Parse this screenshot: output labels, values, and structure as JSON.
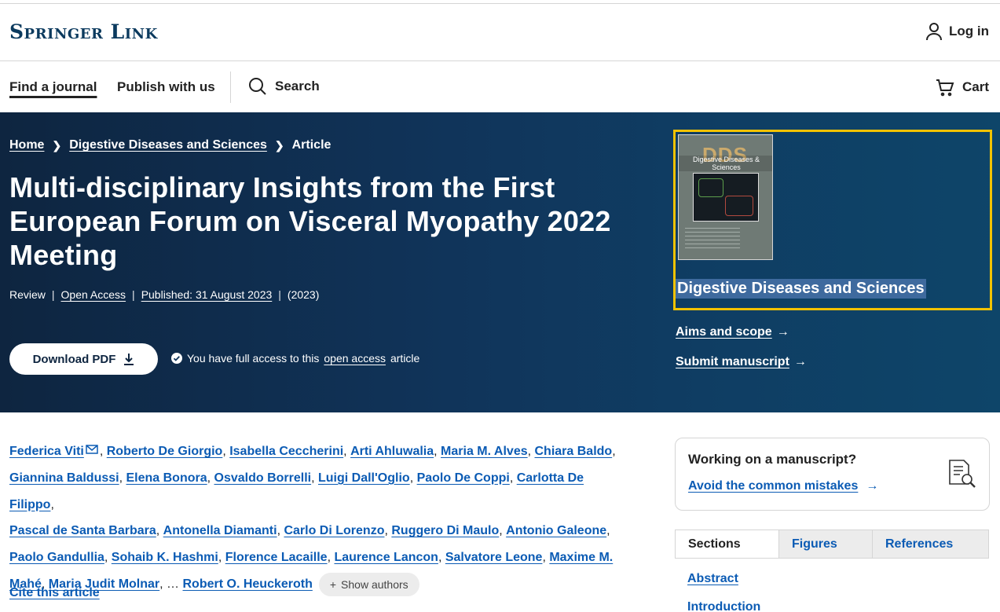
{
  "header": {
    "logo": "Springer Link",
    "login_label": "Log in"
  },
  "nav": {
    "find_journal": "Find a journal",
    "publish": "Publish with us",
    "search": "Search",
    "cart": "Cart"
  },
  "breadcrumb": {
    "home": "Home",
    "journal": "Digestive Diseases and Sciences",
    "current": "Article"
  },
  "article": {
    "title": "Multi-disciplinary Insights from the First European Forum on Visceral Myopathy 2022 Meeting",
    "type": "Review",
    "open_access": "Open Access",
    "published": "Published: 31 August 2023",
    "year": "(2023)",
    "download_label": "Download PDF",
    "access_prefix": "You have full access to this",
    "access_link": "open access",
    "access_suffix": "article"
  },
  "journal": {
    "name": "Digestive Diseases and Sciences",
    "cover_title": "Digestive Diseases & Sciences",
    "cover_abbrev": "DDS",
    "aims": "Aims and scope",
    "submit": "Submit manuscript"
  },
  "authors": [
    "Federica Viti",
    "Roberto De Giorgio",
    "Isabella Ceccherini",
    "Arti Ahluwalia",
    "Maria M. Alves",
    "Chiara Baldo",
    "Giannina Baldussi",
    "Elena Bonora",
    "Osvaldo Borrelli",
    "Luigi Dall'Oglio",
    "Paolo De Coppi",
    "Carlotta De Filippo",
    "Pascal de Santa Barbara",
    "Antonella Diamanti",
    "Carlo Di Lorenzo",
    "Ruggero Di Maulo",
    "Antonio Galeone",
    "Paolo Gandullia",
    "Sohaib K. Hashmi",
    "Florence Lacaille",
    "Laurence Lancon",
    "Salvatore Leone",
    "Maxime M. Mahé",
    "Maria Judit Molnar",
    "Robert O. Heuckeroth"
  ],
  "authors_ellipsis": "…",
  "show_authors": "Show authors",
  "cite": "Cite this article",
  "manuscript": {
    "question": "Working on a manuscript?",
    "link": "Avoid the common mistakes"
  },
  "tabs": [
    "Sections",
    "Figures",
    "References"
  ],
  "sections": [
    "Abstract",
    "Introduction"
  ]
}
